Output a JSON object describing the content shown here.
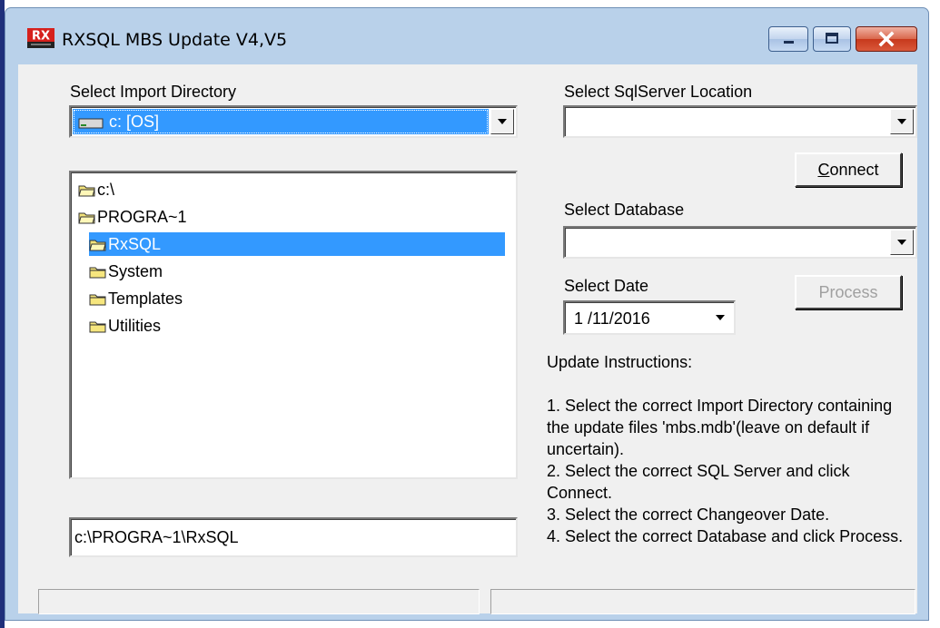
{
  "window": {
    "title": "RXSQL MBS Update V4,V5",
    "logo_text": "RX",
    "logo_colors": {
      "red": "#d6201c",
      "dark": "#222222"
    }
  },
  "import": {
    "label": "Select Import Directory",
    "drive_value": "c: [OS]",
    "tree": [
      {
        "label": "c:\\",
        "level": 0,
        "icon": "open-folder-icon",
        "selected": false
      },
      {
        "label": "PROGRA~1",
        "level": 0,
        "icon": "open-folder-icon",
        "selected": false
      },
      {
        "label": "RxSQL",
        "level": 1,
        "icon": "open-folder-icon",
        "selected": true
      },
      {
        "label": "System",
        "level": 1,
        "icon": "folder-icon",
        "selected": false
      },
      {
        "label": "Templates",
        "level": 1,
        "icon": "folder-icon",
        "selected": false
      },
      {
        "label": "Utilities",
        "level": 1,
        "icon": "folder-icon",
        "selected": false
      }
    ],
    "path_value": "c:\\PROGRA~1\\RxSQL"
  },
  "server": {
    "label": "Select SqlServer Location",
    "value": "",
    "connect_key": "C",
    "connect_rest": "onnect"
  },
  "database": {
    "label": "Select Database",
    "value": ""
  },
  "date": {
    "label": "Select Date",
    "value": "1 /11/2016"
  },
  "process": {
    "label": "Process",
    "enabled": false
  },
  "instructions": {
    "heading": "Update Instructions:",
    "steps": [
      "1. Select the correct Import Directory containing the update files 'mbs.mdb'(leave on default if uncertain).",
      "2. Select the correct SQL Server and click Connect.",
      "3. Select the correct Changeover Date.",
      "4. Select the correct Database and click Process."
    ]
  },
  "colors": {
    "selection": "#3399ff",
    "frame": "#b9d1ea",
    "face": "#f0f0f0"
  }
}
